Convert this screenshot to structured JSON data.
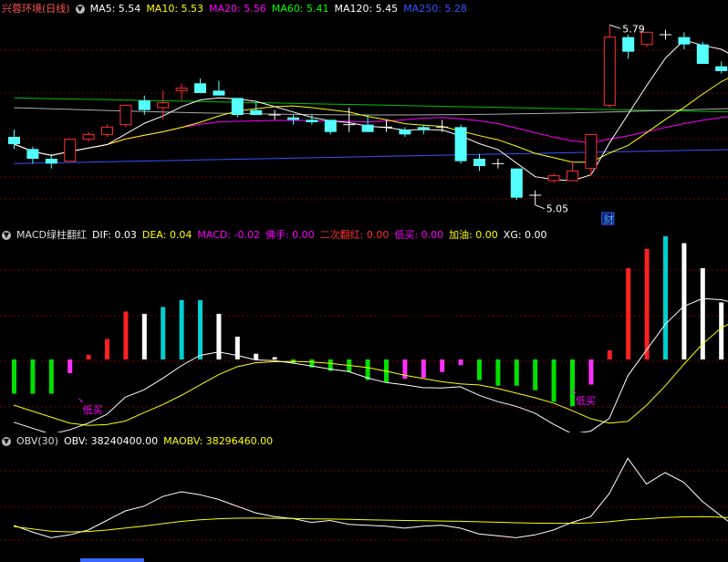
{
  "stock": {
    "title": "兴蓉环境(日线)"
  },
  "price_panel": {
    "indicators": [
      {
        "label": "MA5: 5.54",
        "color": "#ffffff"
      },
      {
        "label": "MA10: 5.53",
        "color": "#ffff00"
      },
      {
        "label": "MA20: 5.56",
        "color": "#ff00ff"
      },
      {
        "label": "MA60: 5.41",
        "color": "#00ff00"
      },
      {
        "label": "MA120: 5.45",
        "color": "#ffffff"
      },
      {
        "label": "MA250: 5.28",
        "color": "#3355ff"
      }
    ],
    "high_label": "5.79",
    "low_label": "5.05",
    "badge": "财"
  },
  "macd_panel": {
    "title": "MACD绿柱翻红",
    "indicators": [
      {
        "label": "DIF: 0.03",
        "color": "#ffffff"
      },
      {
        "label": "DEA: 0.04",
        "color": "#ffff00"
      },
      {
        "label": "MACD: -0.02",
        "color": "#ff00ff"
      },
      {
        "label": "佛手: 0.00",
        "color": "#ff00ff"
      },
      {
        "label": "二次翻红: 0.00",
        "color": "#ff3030"
      },
      {
        "label": "低买: 0.00",
        "color": "#ff00ff"
      },
      {
        "label": "加油: 0.00",
        "color": "#ffff00"
      },
      {
        "label": "XG: 0.00",
        "color": "#ffffff"
      }
    ],
    "signal_label_1": "低买",
    "signal_label_2": "低买"
  },
  "obv_panel": {
    "title": "OBV(30)",
    "indicators": [
      {
        "label": "OBV: 38240400.00",
        "color": "#ffffff"
      },
      {
        "label": "MAOBV: 38296460.00",
        "color": "#ffff00"
      }
    ]
  },
  "colors": {
    "up": "#ff3030",
    "down": "#54ffff",
    "grid": "#800000"
  },
  "candles": [
    {
      "o": 5.33,
      "h": 5.36,
      "l": 5.28,
      "c": 5.3
    },
    {
      "o": 5.28,
      "h": 5.29,
      "l": 5.22,
      "c": 5.24
    },
    {
      "o": 5.24,
      "h": 5.26,
      "l": 5.2,
      "c": 5.22
    },
    {
      "o": 5.23,
      "h": 5.32,
      "l": 5.23,
      "c": 5.32
    },
    {
      "o": 5.32,
      "h": 5.35,
      "l": 5.31,
      "c": 5.34
    },
    {
      "o": 5.34,
      "h": 5.38,
      "l": 5.33,
      "c": 5.37
    },
    {
      "o": 5.38,
      "h": 5.46,
      "l": 5.37,
      "c": 5.46
    },
    {
      "o": 5.48,
      "h": 5.5,
      "l": 5.42,
      "c": 5.44
    },
    {
      "o": 5.45,
      "h": 5.52,
      "l": 5.4,
      "c": 5.47
    },
    {
      "o": 5.52,
      "h": 5.55,
      "l": 5.48,
      "c": 5.53
    },
    {
      "o": 5.55,
      "h": 5.57,
      "l": 5.51,
      "c": 5.51
    },
    {
      "o": 5.52,
      "h": 5.56,
      "l": 5.5,
      "c": 5.5
    },
    {
      "o": 5.49,
      "h": 5.49,
      "l": 5.41,
      "c": 5.42
    },
    {
      "o": 5.44,
      "h": 5.47,
      "l": 5.42,
      "c": 5.42
    },
    {
      "o": 5.42,
      "h": 5.44,
      "l": 5.4,
      "c": 5.42
    },
    {
      "o": 5.41,
      "h": 5.42,
      "l": 5.38,
      "c": 5.4
    },
    {
      "o": 5.4,
      "h": 5.42,
      "l": 5.38,
      "c": 5.39
    },
    {
      "o": 5.4,
      "h": 5.4,
      "l": 5.34,
      "c": 5.35
    },
    {
      "o": 5.38,
      "h": 5.45,
      "l": 5.35,
      "c": 5.38
    },
    {
      "o": 5.38,
      "h": 5.42,
      "l": 5.35,
      "c": 5.35
    },
    {
      "o": 5.37,
      "h": 5.4,
      "l": 5.35,
      "c": 5.37
    },
    {
      "o": 5.36,
      "h": 5.37,
      "l": 5.33,
      "c": 5.34
    },
    {
      "o": 5.37,
      "h": 5.38,
      "l": 5.34,
      "c": 5.36
    },
    {
      "o": 5.37,
      "h": 5.4,
      "l": 5.35,
      "c": 5.37
    },
    {
      "o": 5.37,
      "h": 5.38,
      "l": 5.22,
      "c": 5.23
    },
    {
      "o": 5.24,
      "h": 5.26,
      "l": 5.19,
      "c": 5.21
    },
    {
      "o": 5.22,
      "h": 5.24,
      "l": 5.2,
      "c": 5.22
    },
    {
      "o": 5.2,
      "h": 5.2,
      "l": 5.07,
      "c": 5.08
    },
    {
      "o": 5.09,
      "h": 5.11,
      "l": 5.05,
      "c": 5.09
    },
    {
      "o": 5.15,
      "h": 5.18,
      "l": 5.14,
      "c": 5.17
    },
    {
      "o": 5.15,
      "h": 5.23,
      "l": 5.15,
      "c": 5.19
    },
    {
      "o": 5.2,
      "h": 5.34,
      "l": 5.17,
      "c": 5.34
    },
    {
      "o": 5.46,
      "h": 5.79,
      "l": 5.45,
      "c": 5.74
    },
    {
      "o": 5.74,
      "h": 5.75,
      "l": 5.65,
      "c": 5.68
    },
    {
      "o": 5.71,
      "h": 5.76,
      "l": 5.7,
      "c": 5.76
    },
    {
      "o": 5.75,
      "h": 5.77,
      "l": 5.73,
      "c": 5.75
    },
    {
      "o": 5.74,
      "h": 5.76,
      "l": 5.69,
      "c": 5.71
    },
    {
      "o": 5.71,
      "h": 5.72,
      "l": 5.63,
      "c": 5.63
    },
    {
      "o": 5.62,
      "h": 5.64,
      "l": 5.59,
      "c": 5.6
    },
    {
      "o": 5.58,
      "h": 5.6,
      "l": 5.55,
      "c": 5.55
    }
  ],
  "macd_hist": [
    -0.03,
    -0.03,
    -0.03,
    -0.012,
    0.004,
    0.018,
    0.042,
    0.04,
    0.046,
    0.052,
    0.052,
    0.04,
    0.02,
    0.005,
    0.002,
    -0.003,
    -0.007,
    -0.01,
    -0.011,
    -0.018,
    -0.02,
    -0.017,
    -0.016,
    -0.011,
    -0.005,
    -0.018,
    -0.023,
    -0.023,
    -0.027,
    -0.037,
    -0.041,
    -0.022,
    0.008,
    0.08,
    0.097,
    0.108,
    0.102,
    0.08,
    0.05,
    0.025,
    0.015
  ],
  "obv_series": [
    0.25,
    0.18,
    0.12,
    0.15,
    0.2,
    0.3,
    0.4,
    0.45,
    0.55,
    0.6,
    0.57,
    0.52,
    0.45,
    0.38,
    0.34,
    0.32,
    0.28,
    0.3,
    0.26,
    0.25,
    0.24,
    0.22,
    0.24,
    0.25,
    0.22,
    0.16,
    0.14,
    0.12,
    0.15,
    0.2,
    0.28,
    0.34,
    0.58,
    0.95,
    0.68,
    0.8,
    0.7,
    0.5,
    0.35,
    0.2,
    0.15
  ]
}
